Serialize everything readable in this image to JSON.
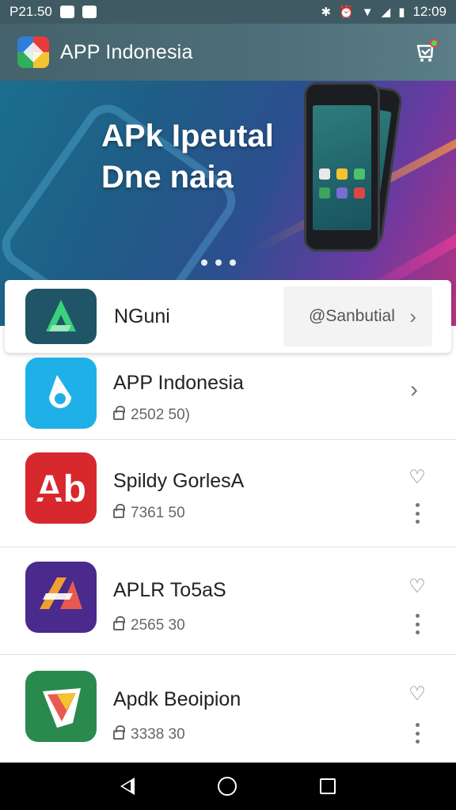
{
  "status_bar": {
    "left_text": "P21.50",
    "time": "12:09"
  },
  "app_bar": {
    "title": "APP Indonesia",
    "logo_icon": "app-logo-icon",
    "cart_icon": "cart-icon"
  },
  "banner": {
    "headline_line1": "APk Ipeutal",
    "headline_line2": "Dne naia",
    "slides_count": 3
  },
  "featured": {
    "title": "NGuni",
    "action_label": "@Sanbutial"
  },
  "list": {
    "items": [
      {
        "title": "APP Indonesia",
        "meta": "2502 50)"
      },
      {
        "title": "Spildy GorlesA",
        "meta": "7361 50"
      },
      {
        "title": "APLR To5aS",
        "meta": "2565 30"
      },
      {
        "title": "Apdk Beoipion",
        "meta": "3338 30"
      }
    ]
  },
  "colors": {
    "app_bar": "#4e6f79",
    "accent_red": "#d7282d",
    "accent_blue": "#1fb0e8",
    "accent_purple": "#4a2a8c",
    "accent_green": "#2a8a4e"
  }
}
